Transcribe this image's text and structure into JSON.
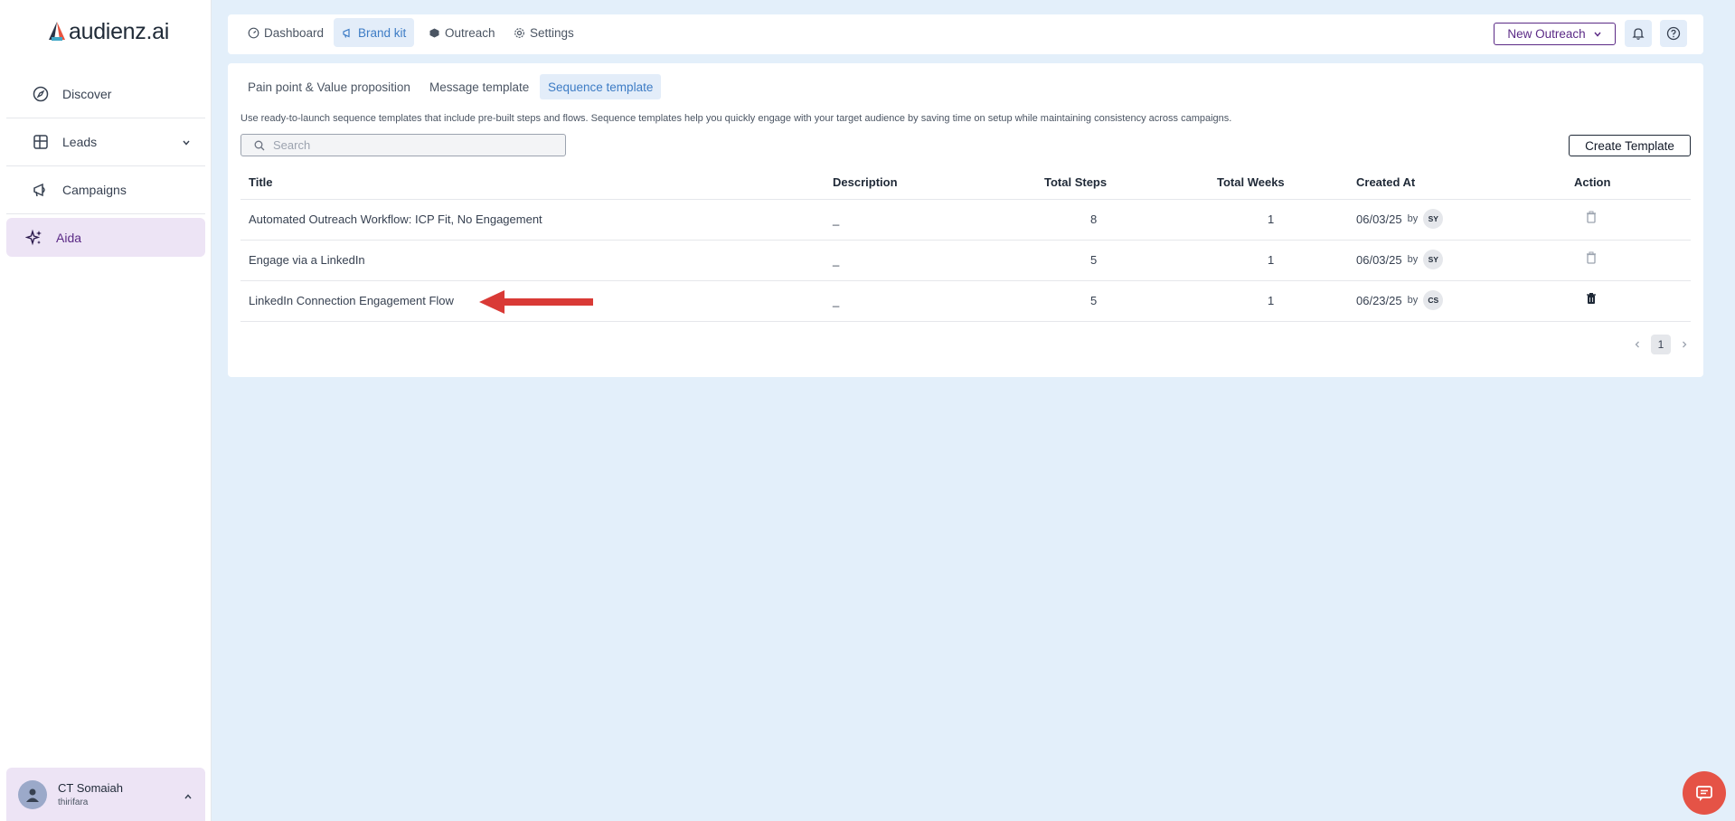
{
  "brand": {
    "name": "audienz.ai"
  },
  "sidebar": {
    "items": [
      {
        "label": "Discover",
        "icon": "compass-icon"
      },
      {
        "label": "Leads",
        "icon": "table-icon"
      },
      {
        "label": "Campaigns",
        "icon": "megaphone-icon"
      },
      {
        "label": "Aida",
        "icon": "sparkles-icon",
        "active": true
      }
    ],
    "user": {
      "name": "CT Somaiah",
      "sub": "thirifara"
    }
  },
  "topbar": {
    "tabs": [
      {
        "label": "Dashboard",
        "icon": "gauge-icon"
      },
      {
        "label": "Brand kit",
        "icon": "megaphone-icon",
        "active": true
      },
      {
        "label": "Outreach",
        "icon": "box-icon"
      },
      {
        "label": "Settings",
        "icon": "gear-icon"
      }
    ],
    "new_outreach": "New Outreach"
  },
  "subtabs": [
    {
      "label": "Pain point & Value proposition"
    },
    {
      "label": "Message template"
    },
    {
      "label": "Sequence template",
      "active": true
    }
  ],
  "description": "Use ready-to-launch sequence templates that include pre-built steps and flows. Sequence templates help you quickly engage with your target audience by saving time on setup while maintaining consistency across campaigns.",
  "search": {
    "placeholder": "Search",
    "value": ""
  },
  "create_button": "Create Template",
  "table": {
    "headers": [
      "Title",
      "Description",
      "Total Steps",
      "Total Weeks",
      "Created At",
      "Action"
    ],
    "by_label": "by",
    "rows": [
      {
        "title": "Automated Outreach Workflow: ICP Fit, No Engagement",
        "description": "_",
        "steps": "8",
        "weeks": "1",
        "created": "06/03/25",
        "initials": "SY"
      },
      {
        "title": "Engage via a LinkedIn",
        "description": "_",
        "steps": "5",
        "weeks": "1",
        "created": "06/03/25",
        "initials": "SY"
      },
      {
        "title": "LinkedIn Connection Engagement Flow",
        "description": "_",
        "steps": "5",
        "weeks": "1",
        "created": "06/23/25",
        "initials": "CS"
      }
    ]
  },
  "pagination": {
    "current": "1"
  },
  "colors": {
    "accent": "#5b2a86",
    "tab_active": "#3d7cc5",
    "annotation": "#d93a36",
    "chat": "#e55346"
  }
}
